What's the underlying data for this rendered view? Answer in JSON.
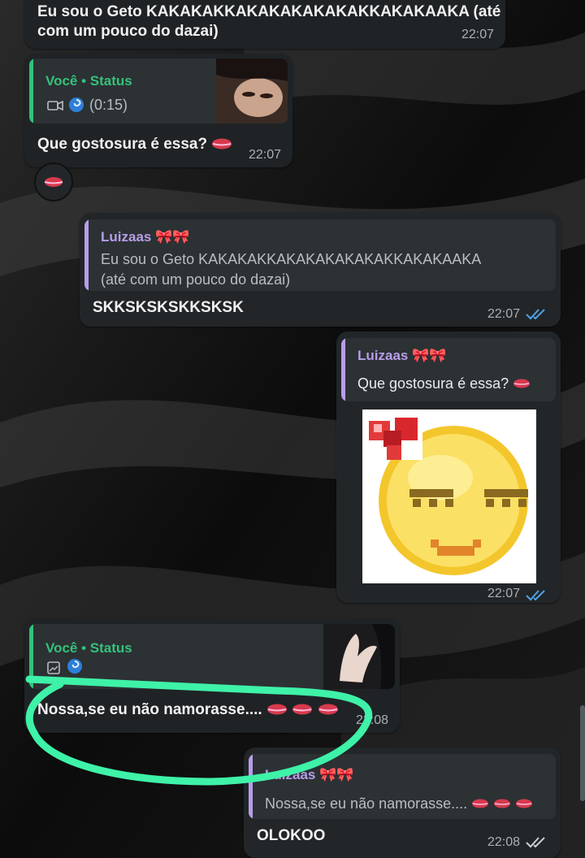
{
  "messages": {
    "m1": {
      "text_line1": "Eu sou o Geto KAKAKAKKAKAKAKAKAKAKKAKAKAAKA (até",
      "text_line2": "com um pouco do dazai)",
      "time": "22:07"
    },
    "m2": {
      "quote_author": "Você • Status",
      "quote_meta": "(0:15)",
      "text": "Que gostosura é essa?",
      "time": "22:07",
      "reaction": "lips-emoji"
    },
    "m3": {
      "quote_author": "Luizaas",
      "quote_line1": "Eu sou o Geto KAKAKAKKAKAKAKAKAKAKKAKAKAAKA",
      "quote_line2": "(até com um pouco do dazai)",
      "text": "SKKSKSKSKKSKSK",
      "time": "22:07"
    },
    "m4": {
      "quote_author": "Luizaas",
      "quote_text": "Que gostosura é essa?",
      "time": "22:07",
      "sticker": "pixel-smiley-sticker"
    },
    "m5": {
      "quote_author": "Você • Status",
      "text": "Nossa,se eu não namorasse....",
      "time": "22:08"
    },
    "m6": {
      "quote_author": "Luizaas",
      "quote_text": "Nossa,se eu não namorasse....",
      "text": "OLOKOO",
      "time": "22:08"
    }
  },
  "colors": {
    "status_green": "#33c27a",
    "quote_purple": "#b79ee8",
    "read_blue": "#4fa3e8",
    "annotation": "#3ef2a8"
  }
}
